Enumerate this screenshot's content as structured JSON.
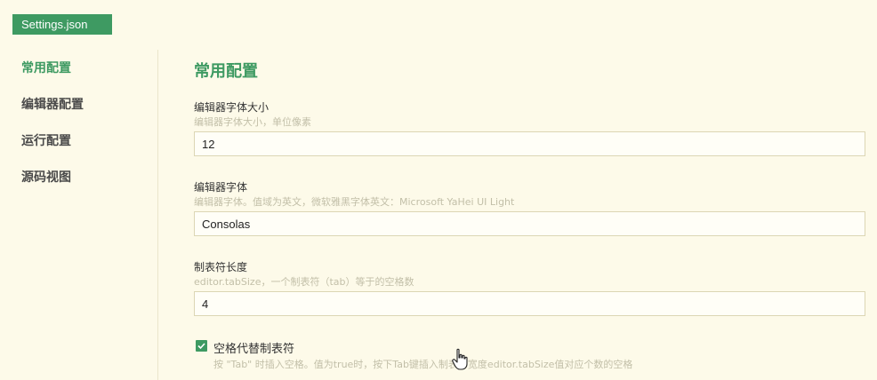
{
  "tab": {
    "title": "Settings.json"
  },
  "sidebar": {
    "items": [
      {
        "label": "常用配置",
        "active": true
      },
      {
        "label": "编辑器配置"
      },
      {
        "label": "运行配置"
      },
      {
        "label": "源码视图"
      }
    ]
  },
  "main": {
    "section_title": "常用配置",
    "fields": [
      {
        "label": "编辑器字体大小",
        "description": "编辑器字体大小，单位像素",
        "value": "12"
      },
      {
        "label": "编辑器字体",
        "description": "编辑器字体。值域为英文，微软雅黑字体英文：Microsoft YaHei UI Light",
        "value": "Consolas"
      },
      {
        "label": "制表符长度",
        "description": "editor.tabSize，一个制表符（tab）等于的空格数",
        "value": "4"
      }
    ],
    "checkbox": {
      "label": "空格代替制表符",
      "description": "按 \"Tab\" 时插入空格。值为true时，按下Tab键插入制表符宽度editor.tabSize值对应个数的空格",
      "checked": true
    }
  },
  "colors": {
    "accent": "#3e9a62",
    "background": "#fdfae9"
  },
  "icons": {
    "checkbox": "check-icon",
    "cursor": "hand-pointer-icon"
  }
}
